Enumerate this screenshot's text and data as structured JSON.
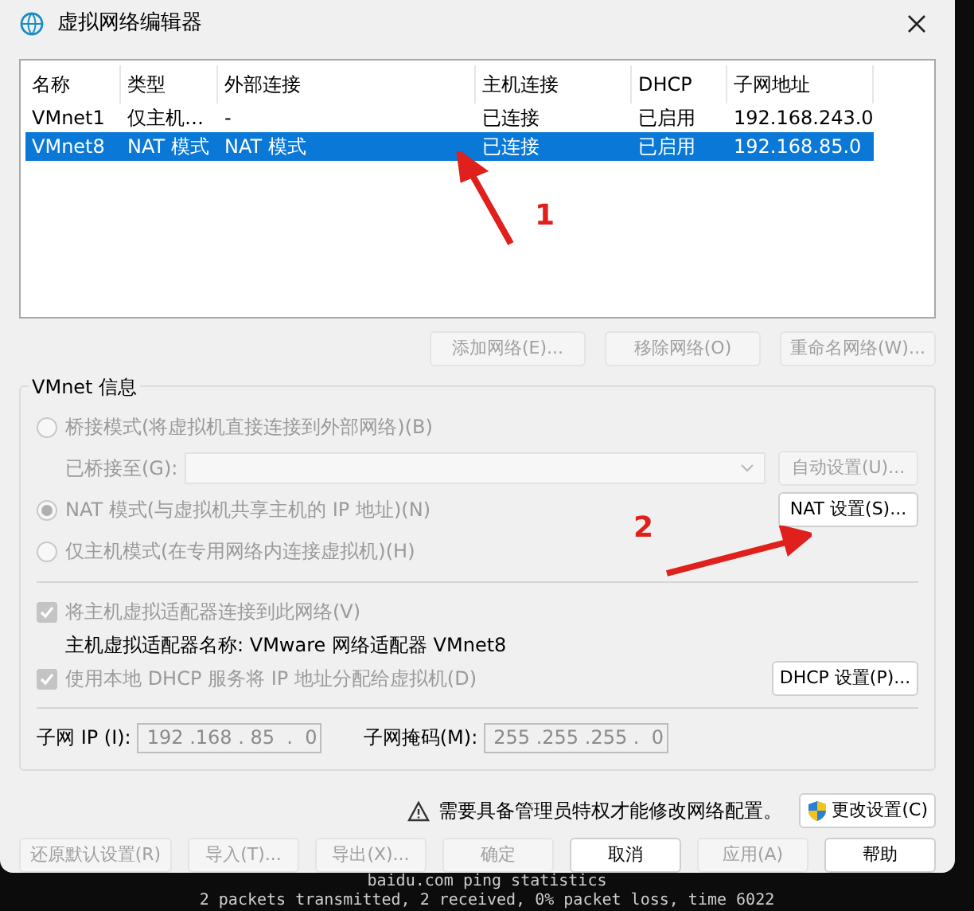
{
  "window": {
    "title": "虚拟网络编辑器"
  },
  "table": {
    "columns": [
      "名称",
      "类型",
      "外部连接",
      "主机连接",
      "DHCP",
      "子网地址"
    ],
    "rows": [
      {
        "cells": [
          "VMnet1",
          "仅主机…",
          "-",
          "已连接",
          "已启用",
          "192.168.243.0"
        ],
        "selected": false
      },
      {
        "cells": [
          "VMnet8",
          "NAT 模式",
          "NAT 模式",
          "已连接",
          "已启用",
          "192.168.85.0"
        ],
        "selected": true
      }
    ]
  },
  "network_buttons": [
    {
      "label": "添加网络(E)...",
      "disabled": true
    },
    {
      "label": "移除网络(O)",
      "disabled": true
    },
    {
      "label": "重命名网络(W)...",
      "disabled": true
    }
  ],
  "vmnet_info": {
    "title": "VMnet 信息",
    "modes": [
      {
        "label": "桥接模式(将虚拟机直接连接到外部网络)(B)",
        "selected": false,
        "disabled": true,
        "bridge": {
          "label": "已桥接至(G):",
          "disabled": true
        },
        "button": {
          "label": "自动设置(U)...",
          "disabled": true
        }
      },
      {
        "label": "NAT 模式(与虚拟机共享主机的 IP 地址)(N)",
        "selected": true,
        "disabled": true,
        "button": {
          "label": "NAT 设置(S)...",
          "disabled": false
        }
      },
      {
        "label": "仅主机模式(在专用网络内连接虚拟机)(H)",
        "selected": false,
        "disabled": true
      }
    ],
    "options": [
      {
        "label": "将主机虚拟适配器连接到此网络(V)",
        "checked": true,
        "disabled": true,
        "detail": "主机虚拟适配器名称: VMware 网络适配器 VMnet8"
      },
      {
        "label": "使用本地 DHCP 服务将 IP 地址分配给虚拟机(D)",
        "checked": true,
        "disabled": true,
        "button": {
          "label": "DHCP 设置(P)...",
          "disabled": false
        }
      }
    ],
    "subnet_ip": {
      "label": "子网 IP (I):",
      "value": "192 .168 . 85  .  0"
    },
    "subnet_mask": {
      "label": "子网掩码(M):",
      "value": "255 .255 .255 .  0"
    }
  },
  "admin_notice": "需要具备管理员特权才能修改网络配置。",
  "change_settings_button": {
    "label": "更改设置(C)",
    "disabled": false
  },
  "footer_buttons": [
    {
      "label": "还原默认设置(R)",
      "disabled": true
    },
    {
      "label": "导入(T)...",
      "disabled": true
    },
    {
      "label": "导出(X)...",
      "disabled": true
    },
    {
      "label": "确定",
      "disabled": true
    },
    {
      "label": "取消",
      "disabled": false
    },
    {
      "label": "应用(A)",
      "disabled": true
    },
    {
      "label": "帮助",
      "disabled": false
    }
  ],
  "annotations": [
    {
      "label": "1"
    },
    {
      "label": "2"
    }
  ],
  "terminal_lines": [
    "baidu.com ping statistics",
    "2 packets transmitted, 2 received, 0% packet loss, time 6022"
  ]
}
